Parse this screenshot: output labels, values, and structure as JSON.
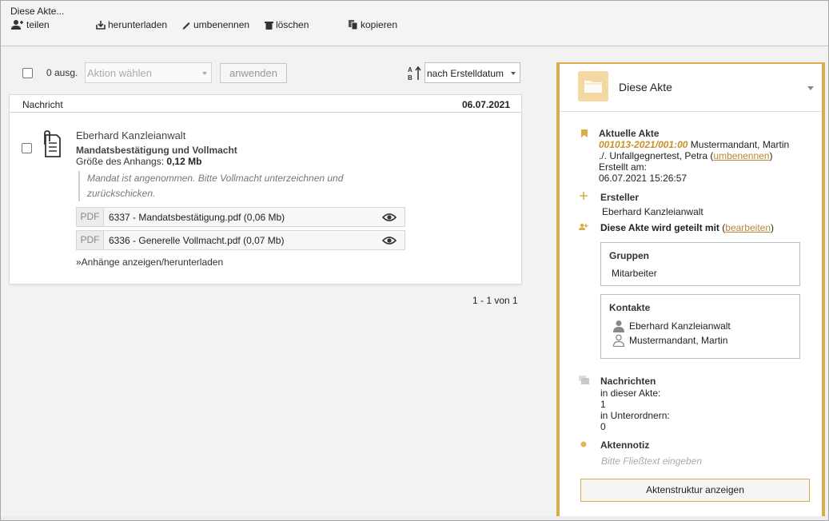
{
  "toolbar": {
    "title": "Diese Akte...",
    "share_label": "teilen",
    "download_label": "herunterladen",
    "rename_label": "umbenennen",
    "delete_label": "löschen",
    "copy_label": "kopieren"
  },
  "controls": {
    "selected_count": "0 ausg.",
    "action_placeholder": "Aktion wählen",
    "apply_label": "anwenden",
    "sort_value": "nach Erstelldatum"
  },
  "list": {
    "header_message": "Nachricht",
    "header_date": "06.07.2021",
    "message": {
      "sender": "Eberhard Kanzleianwalt",
      "subject": "Mandatsbestätigung und Vollmacht",
      "size_label": "Größe des Anhangs:",
      "size_value": "0,12 Mb",
      "body_line1": "Mandat ist angenommen. Bitte Vollmacht unterzeichnen und",
      "body_line2": "zurückschicken.",
      "attachments": [
        {
          "type": "PDF",
          "name": "6337 - Mandatsbestätigung.pdf (0,06 Mb)"
        },
        {
          "type": "PDF",
          "name": "6336 - Generelle Vollmacht.pdf (0,07 Mb)"
        }
      ],
      "show_attachments": "»Anhänge anzeigen/herunterladen"
    },
    "pager": "1 - 1 von 1"
  },
  "side": {
    "title": "Diese Akte",
    "current_label": "Aktuelle Akte",
    "file_number": "001013-2021/001:00",
    "party1": " Mustermandant, Martin",
    "party2": "./. Unfallgegnertest, Petra",
    "rename_link": "umbenennen",
    "created_label": "Erstellt am:",
    "created_value": "06.07.2021 15:26:57",
    "creator_label": "Ersteller",
    "creator_value": "Eberhard Kanzleianwalt",
    "shared_label": "Diese Akte wird geteilt mit",
    "edit_link": "bearbeiten",
    "groups_title": "Gruppen",
    "groups_value": "Mitarbeiter",
    "contacts_title": "Kontakte",
    "contacts": [
      "Eberhard Kanzleianwalt",
      "Mustermandant, Martin"
    ],
    "messages_label": "Nachrichten",
    "in_file_label": "in dieser Akte:",
    "in_file_value": "1",
    "in_sub_label": "in Unterordnern:",
    "in_sub_value": "0",
    "note_label": "Aktennotiz",
    "note_placeholder": "Bitte Fließtext eingeben",
    "structure_button": "Aktenstruktur anzeigen"
  },
  "colors": {
    "accent": "#d9ad4a",
    "link": "#b8862f",
    "file_number": "#c8912a"
  }
}
